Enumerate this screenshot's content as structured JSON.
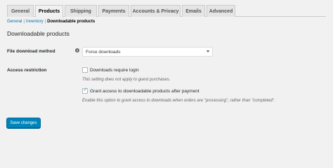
{
  "tabs": [
    "General",
    "Products",
    "Shipping",
    "Payments",
    "Accounts & Privacy",
    "Emails",
    "Advanced"
  ],
  "active_tab": "Products",
  "subnav": {
    "general": "General",
    "inventory": "Inventory",
    "current": "Downloadable products"
  },
  "section_title": "Downloadable products",
  "file_download": {
    "label": "File download method",
    "help": "?",
    "value": "Force downloads"
  },
  "access": {
    "label": "Access restriction",
    "require_login": {
      "label": "Downloads require login",
      "checked": false,
      "description": "This setting does not apply to guest purchases."
    },
    "grant_access": {
      "label": "Grant access to downloadable products after payment",
      "checked": true,
      "description": "Enable this option to grant access to downloads when orders are \"processing\", rather than \"completed\"."
    }
  },
  "save_label": "Save changes",
  "colors": {
    "accent": "#0085ba",
    "link": "#0073aa",
    "check": "#1e8cbe"
  }
}
